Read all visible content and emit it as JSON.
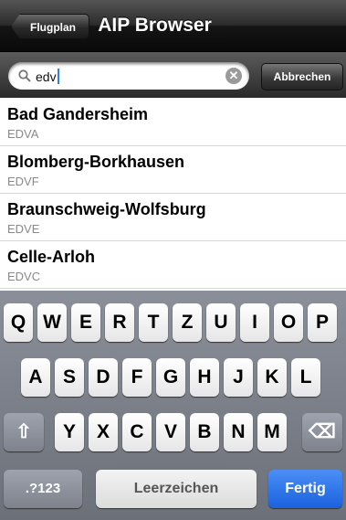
{
  "navbar": {
    "back_label": "Flugplan",
    "title": "AIP Browser"
  },
  "search": {
    "query": "edv",
    "cancel_label": "Abbrechen",
    "clear_symbol": "✕"
  },
  "results": [
    {
      "name": "Bad Gandersheim",
      "code": "EDVA"
    },
    {
      "name": "Blomberg-Borkhausen",
      "code": "EDVF"
    },
    {
      "name": "Braunschweig-Wolfsburg",
      "code": "EDVE"
    },
    {
      "name": "Celle-Arloh",
      "code": "EDVC"
    }
  ],
  "keyboard": {
    "row1": [
      "Q",
      "W",
      "E",
      "R",
      "T",
      "Z",
      "U",
      "I",
      "O",
      "P"
    ],
    "row2": [
      "A",
      "S",
      "D",
      "F",
      "G",
      "H",
      "J",
      "K",
      "L"
    ],
    "row3": [
      "Y",
      "X",
      "C",
      "V",
      "B",
      "N",
      "M"
    ],
    "shift_symbol": "⇧",
    "delete_symbol": "⌫",
    "numbers_label": ".?123",
    "space_label": "Leerzeichen",
    "done_label": "Fertig"
  }
}
